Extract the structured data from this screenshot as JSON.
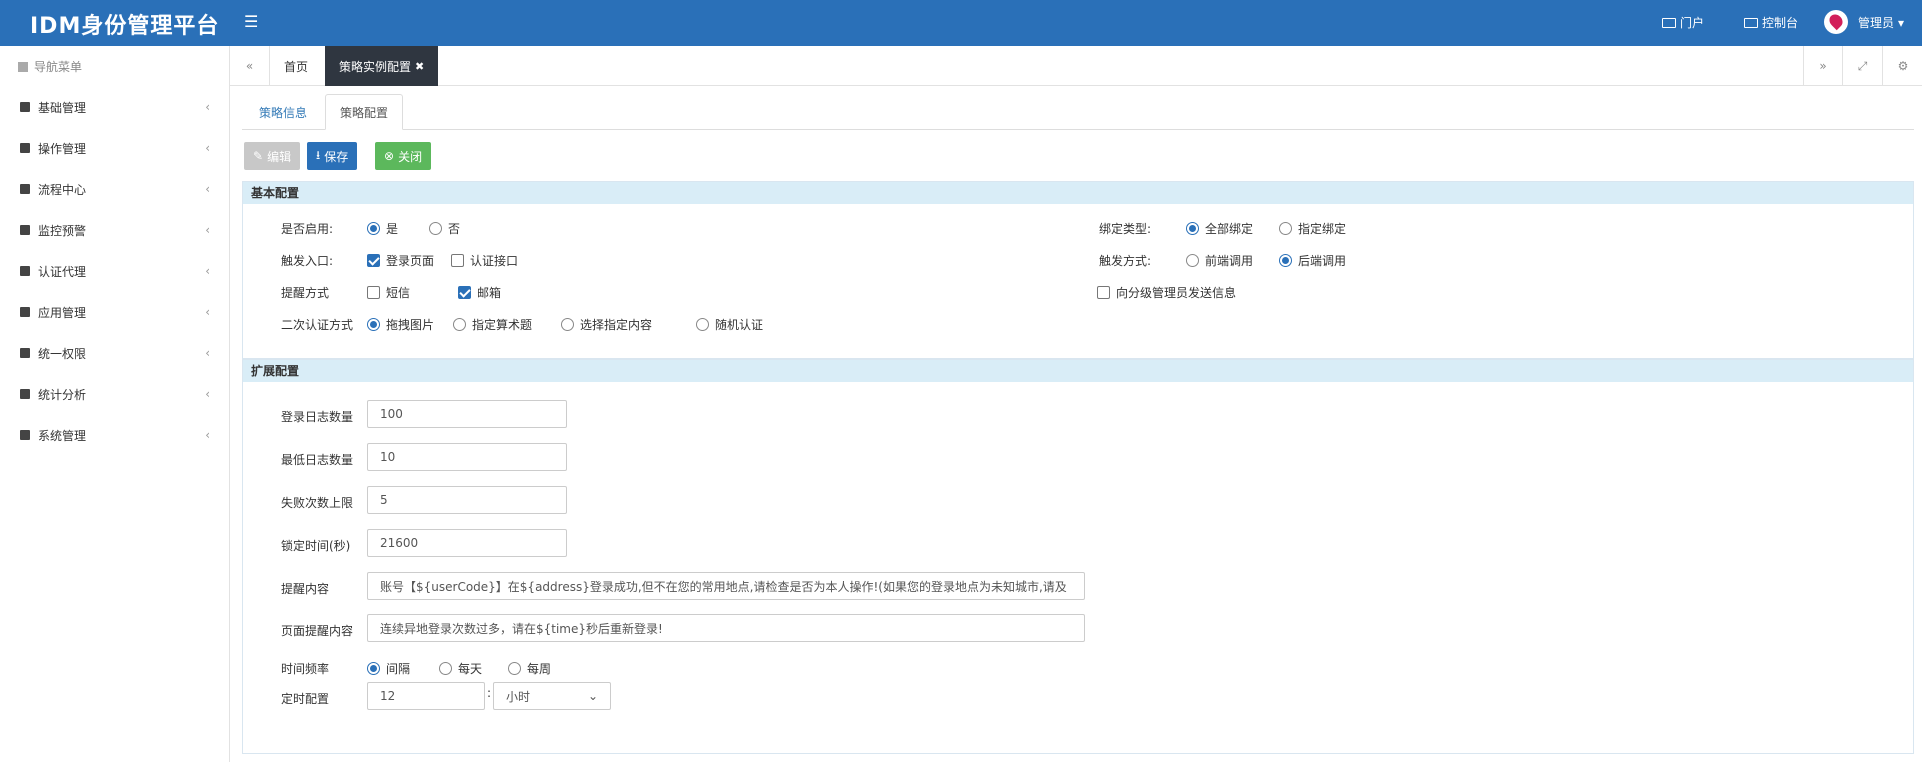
{
  "header": {
    "brand": "IDM身份管理平台",
    "portal": "门户",
    "console": "控制台",
    "user": "管理员"
  },
  "sidebar": {
    "title": "导航菜单",
    "items": [
      {
        "label": "基础管理"
      },
      {
        "label": "操作管理"
      },
      {
        "label": "流程中心"
      },
      {
        "label": "监控预警"
      },
      {
        "label": "认证代理"
      },
      {
        "label": "应用管理"
      },
      {
        "label": "统一权限"
      },
      {
        "label": "统计分析"
      },
      {
        "label": "系统管理"
      }
    ]
  },
  "tabs": {
    "home": "首页",
    "active": "策略实例配置"
  },
  "subtabs": {
    "info": "策略信息",
    "config": "策略配置"
  },
  "toolbar": {
    "edit": "编辑",
    "save": "保存",
    "close": "关闭"
  },
  "basic": {
    "title": "基本配置",
    "enabled_label": "是否启用:",
    "enabled_yes": "是",
    "enabled_no": "否",
    "bind_type_label": "绑定类型:",
    "bind_all": "全部绑定",
    "bind_specified": "指定绑定",
    "trigger_entry_label": "触发入口:",
    "entry_login": "登录页面",
    "entry_auth": "认证接口",
    "trigger_mode_label": "触发方式:",
    "mode_front": "前端调用",
    "mode_back": "后端调用",
    "remind_label": "提醒方式",
    "remind_sms": "短信",
    "remind_email": "邮箱",
    "remind_admin": "向分级管理员发送信息",
    "second_auth_label": "二次认证方式",
    "second_drag": "拖拽图片",
    "second_math": "指定算术题",
    "second_select": "选择指定内容",
    "second_random": "随机认证"
  },
  "ext": {
    "title": "扩展配置",
    "login_log_label": "登录日志数量",
    "login_log_value": "100",
    "min_log_label": "最低日志数量",
    "min_log_value": "10",
    "fail_limit_label": "失败次数上限",
    "fail_limit_value": "5",
    "lock_time_label": "锁定时间(秒)",
    "lock_time_value": "21600",
    "remind_content_label": "提醒内容",
    "remind_content_value": "账号【${userCode}】在${address}登录成功,但不在您的常用地点,请检查是否为本人操作!(如果您的登录地点为未知城市,请及",
    "page_remind_label": "页面提醒内容",
    "page_remind_value": "连续异地登录次数过多，请在${time}秒后重新登录!",
    "freq_label": "时间频率",
    "freq_interval": "间隔",
    "freq_daily": "每天",
    "freq_weekly": "每周",
    "timer_label": "定时配置",
    "timer_value": "12",
    "timer_sep": ":",
    "timer_unit": "小时"
  }
}
